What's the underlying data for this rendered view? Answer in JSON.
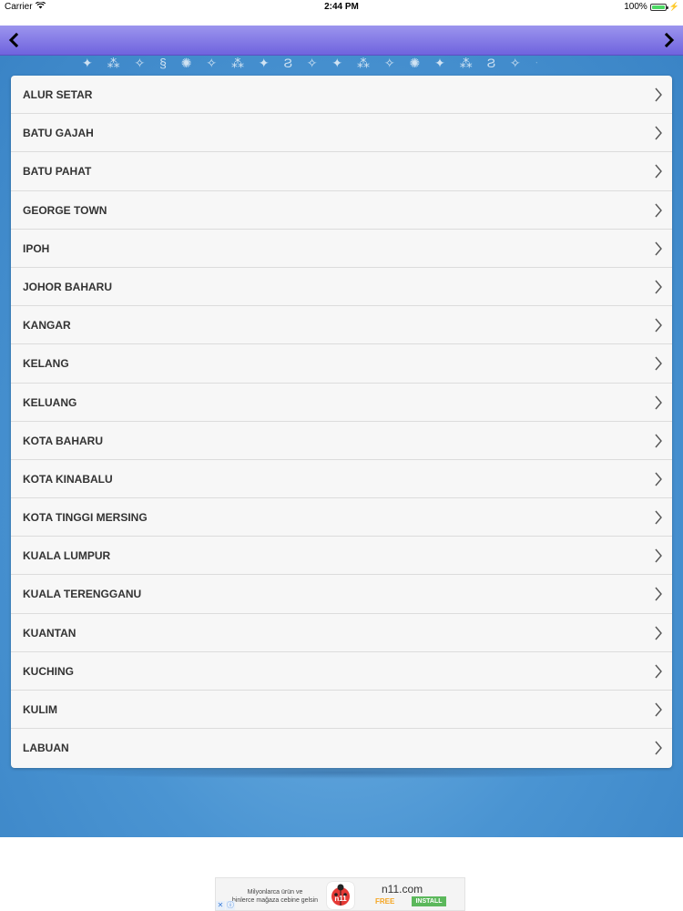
{
  "status_bar": {
    "carrier": "Carrier",
    "time": "2:44 PM",
    "battery": "100%",
    "battery_level": 1.0
  },
  "nav": {
    "back_icon": "chevron-left-icon",
    "forward_icon": "chevron-right-icon"
  },
  "background": {
    "sparkles": "✦ ⁂ ✧ § ✺ ✧ ⁂ ✦ Ϩ ✧ ✦ ⁂ ✧ ✺ ✦ ⁂ Ϩ ✧ ✦ ⁂"
  },
  "cities": [
    "ALUR SETAR",
    "BATU GAJAH",
    "BATU PAHAT",
    "GEORGE TOWN",
    "IPOH",
    "JOHOR BAHARU",
    "KANGAR",
    "KELANG",
    "KELUANG",
    "KOTA BAHARU",
    "KOTA KINABALU",
    "KOTA TINGGI MERSING",
    "KUALA LUMPUR",
    "KUALA TERENGGANU",
    "KUANTAN",
    "KUCHING",
    "KULIM",
    "LABUAN"
  ],
  "ad": {
    "line1": "Milyonlarca ürün ve",
    "line2": "binlerce mağaza cebine gelsin",
    "logo_text": "n11",
    "site": "n11.com",
    "free_label": "FREE",
    "install_label": "INSTALL"
  },
  "colors": {
    "nav_bar": "#7b70e3",
    "background": "#4a94d2",
    "chevron": "#555555"
  }
}
